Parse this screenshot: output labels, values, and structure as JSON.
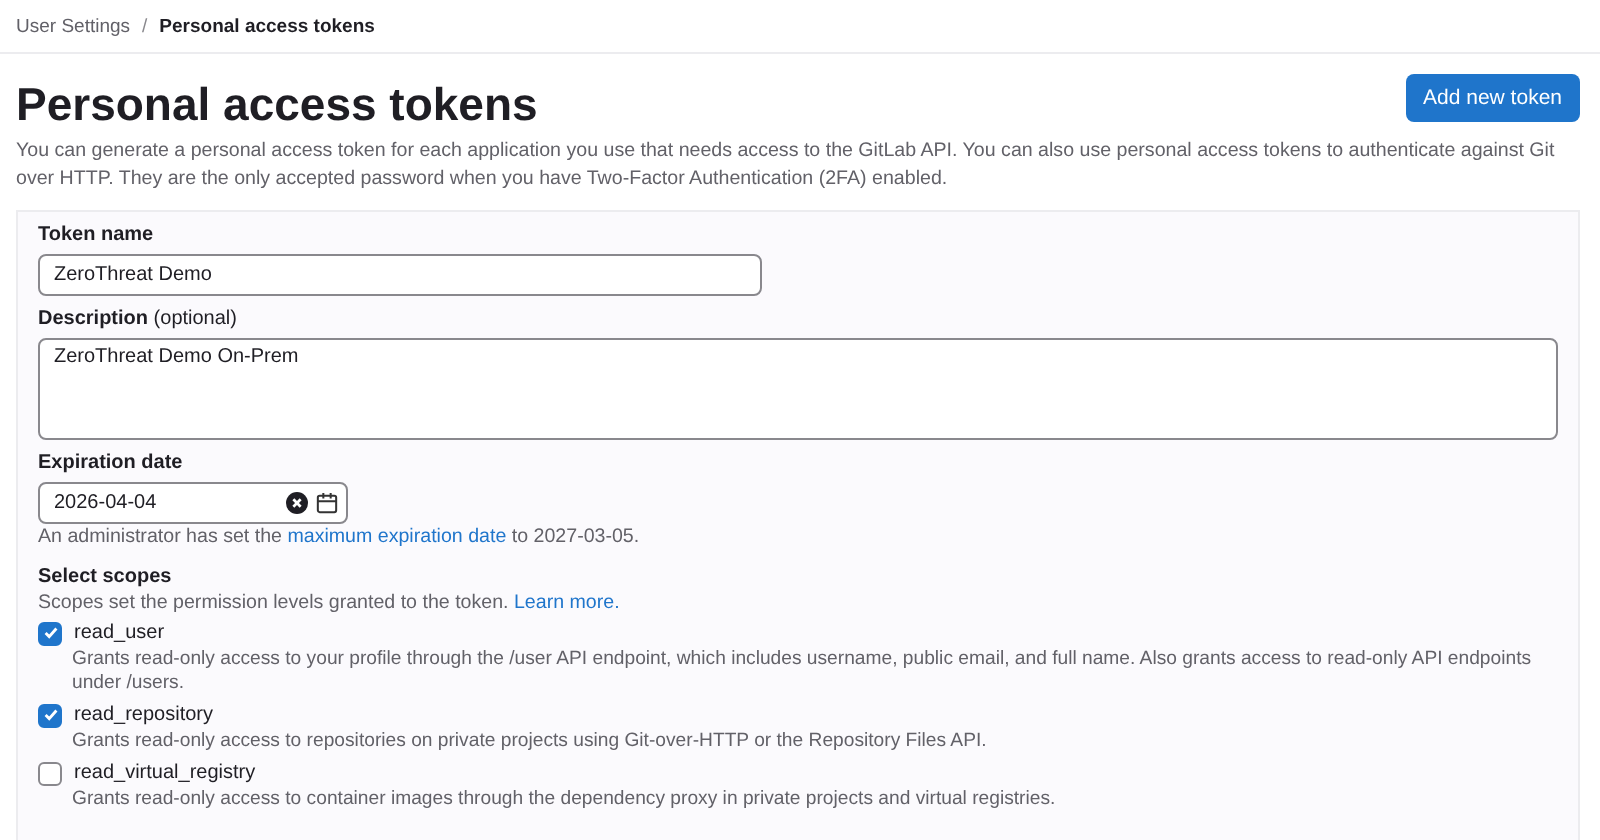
{
  "breadcrumb_separator": "/",
  "breadcrumb": [
    {
      "label": "User Settings",
      "current": false
    },
    {
      "label": "Personal access tokens",
      "current": true
    }
  ],
  "title": "Personal access tokens",
  "add_button": "Add new token",
  "intro": "You can generate a personal access token for each application you use that needs access to the GitLab API. You can also use personal access tokens to authenticate against Git over HTTP. They are the only accepted password when you have Two-Factor Authentication (2FA) enabled.",
  "form": {
    "token_name": {
      "label": "Token name",
      "value": "ZeroThreat Demo"
    },
    "description": {
      "label": "Description",
      "optional": "(optional)",
      "value": "ZeroThreat Demo On-Prem"
    },
    "expiration": {
      "label": "Expiration date",
      "value": "2026-04-04",
      "help_before": "An administrator has set the",
      "help_link": "maximum expiration date",
      "help_after": "to 2027-03-05."
    },
    "scopes": {
      "label": "Select scopes",
      "help": "Scopes set the permission levels granted to the token.",
      "help_link": "Learn more.",
      "items": [
        {
          "name": "read_user",
          "checked": true,
          "description": "Grants read-only access to your profile through the /user API endpoint, which includes username, public email, and full name. Also grants access to read-only API endpoints under /users."
        },
        {
          "name": "read_repository",
          "checked": true,
          "description": "Grants read-only access to repositories on private projects using Git-over-HTTP or the Repository Files API."
        },
        {
          "name": "read_virtual_registry",
          "checked": false,
          "description": "Grants read-only access to container images through the dependency proxy in private projects and virtual registries."
        }
      ]
    }
  }
}
